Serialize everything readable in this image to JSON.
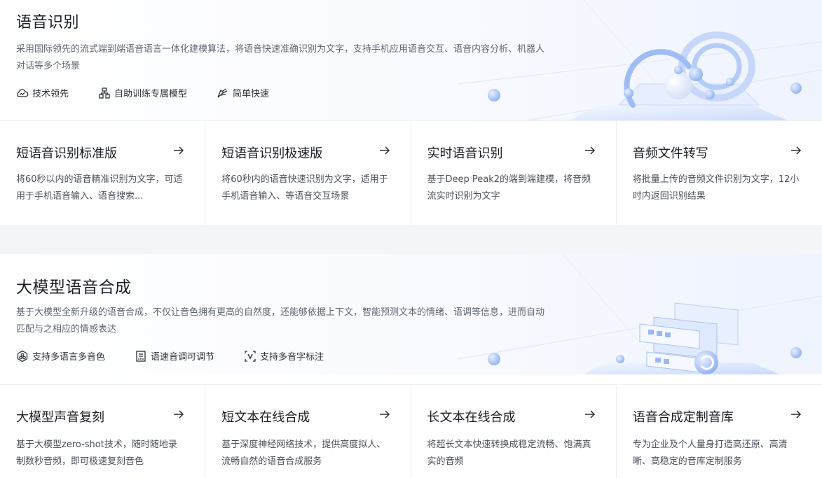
{
  "speech_recognition": {
    "title": "语音识别",
    "description": "采用国际领先的流式端到端语音语言一体化建模算法，将语音快速准确识别为文字，支持手机应用语音交互、语音内容分析、机器人对话等多个场景",
    "features": [
      {
        "icon": "cloud-wave-icon",
        "label": "技术领先"
      },
      {
        "icon": "model-training-icon",
        "label": "自助训练专属模型"
      },
      {
        "icon": "fast-pen-icon",
        "label": "简单快速"
      }
    ],
    "cards": [
      {
        "title": "短语音识别标准版",
        "desc": "将60秒以内的语音精准识别为文字，可适用于手机语音输入、语音搜索..."
      },
      {
        "title": "短语音识别极速版",
        "desc": "将60秒内的语音快速识别为文字，适用于手机语音输入、等语音交互场景"
      },
      {
        "title": "实时语音识别",
        "desc": "基于Deep Peak2的端到端建模，将音频流实时识别为文字"
      },
      {
        "title": "音频文件转写",
        "desc": "将批量上传的音频文件识别为文字，12小时内返回识别结果"
      }
    ]
  },
  "tts": {
    "title": "大模型语音合成",
    "description": "基于大模型全新升级的语音合成，不仅让音色拥有更高的自然度，还能够依据上下文，智能预测文本的情绪、语调等信息，进而自动匹配与之相应的情感表达",
    "features": [
      {
        "icon": "multilang-icon",
        "label": "支持多语言多音色"
      },
      {
        "icon": "speed-adjust-icon",
        "label": "语速音调可调节"
      },
      {
        "icon": "polyphone-icon",
        "label": "支持多音字标注"
      }
    ],
    "cards": [
      {
        "title": "大模型声音复刻",
        "desc": "基于大模型zero-shot技术，随时随地录制数秒音频，即可极速复刻音色"
      },
      {
        "title": "短文本在线合成",
        "desc": "基于深度神经网络技术，提供高度拟人、流畅自然的语音合成服务"
      },
      {
        "title": "长文本在线合成",
        "desc": "将超长文本快速转换成稳定流畅、饱满真实的音频"
      },
      {
        "title": "语音合成定制音库",
        "desc": "专为企业及个人量身打造高还原、高清晰、高稳定的音库定制服务"
      }
    ]
  },
  "colors": {
    "accent": "#2468f2",
    "deco_blue": "#9bb8f5"
  }
}
